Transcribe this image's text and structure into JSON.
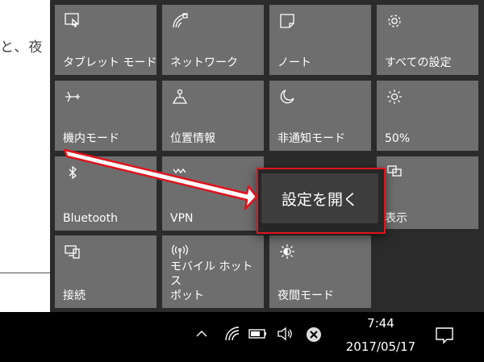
{
  "background_doc": {
    "text": "と、夜"
  },
  "tiles": [
    {
      "label": "タブレット モード",
      "icon": "tablet-mode-icon"
    },
    {
      "label": "ネットワーク",
      "icon": "network-icon"
    },
    {
      "label": "ノート",
      "icon": "note-icon"
    },
    {
      "label": "すべての設定",
      "icon": "gear-icon"
    },
    {
      "label": "機内モード",
      "icon": "airplane-icon"
    },
    {
      "label": "位置情報",
      "icon": "location-icon"
    },
    {
      "label": "非通知モード",
      "icon": "moon-icon"
    },
    {
      "label": "50%",
      "icon": "brightness-icon"
    },
    {
      "label": "Bluetooth",
      "icon": "bluetooth-icon"
    },
    {
      "label": "VPN",
      "icon": "vpn-icon"
    },
    {
      "label": "表示",
      "icon": "project-icon"
    },
    {
      "label": "接続",
      "icon": "connect-icon"
    },
    {
      "label": "モバイル ホットス\nポット",
      "icon": "hotspot-icon"
    },
    {
      "label": "夜間モード",
      "icon": "night-light-icon"
    }
  ],
  "context_menu": {
    "item": "設定を開く"
  },
  "taskbar": {
    "time": "7:44",
    "date": "2017/05/17",
    "icons": [
      "chevron-up-icon",
      "wifi-icon",
      "battery-icon",
      "volume-icon",
      "error-icon",
      "action-center-icon"
    ]
  },
  "annotation": {
    "color": "#e0141e"
  }
}
